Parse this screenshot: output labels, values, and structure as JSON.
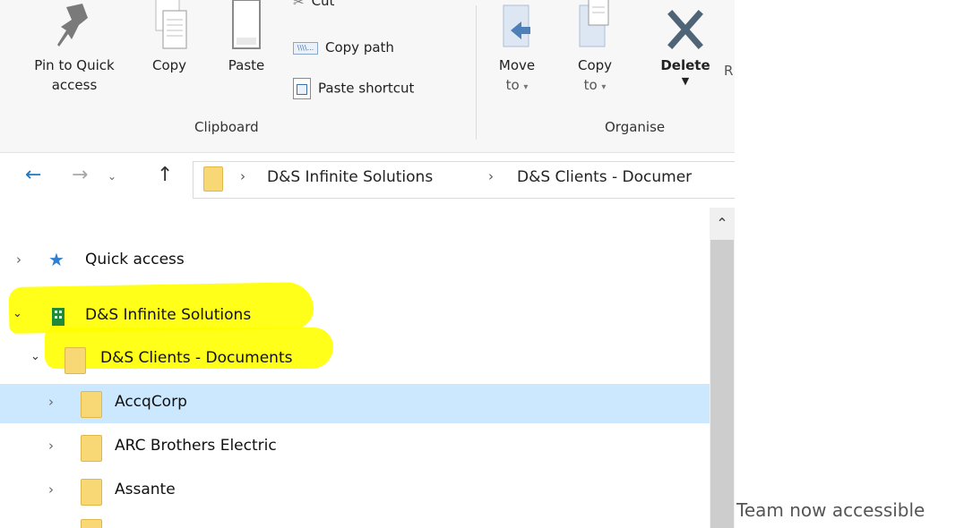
{
  "ribbon": {
    "pin": {
      "line1": "Pin to Quick",
      "line2": "access"
    },
    "copy": "Copy",
    "paste": "Paste",
    "cut": "Cut",
    "copy_path": "Copy path",
    "paste_shortcut": "Paste shortcut",
    "clipboard_group": "Clipboard",
    "move_to": {
      "line1": "Move",
      "line2": "to"
    },
    "copy_to": {
      "line1": "Copy",
      "line2": "to"
    },
    "delete": "Delete",
    "rename_partial": "R",
    "organise_group": "Organise"
  },
  "address": {
    "crumbs": [
      "D&S Infinite Solutions",
      "D&S Clients - Documer"
    ]
  },
  "tree": {
    "quick_access": "Quick access",
    "org": "D&S Infinite Solutions",
    "library": "D&S Clients - Documents",
    "folders": [
      "AccqCorp",
      "ARC Brothers Electric",
      "Assante"
    ]
  },
  "caption": "Team now accessible",
  "colors": {
    "selection": "#cce8ff",
    "highlighter": "#ffff00",
    "folder": "#f8d775",
    "nav_blue": "#1979ca"
  }
}
